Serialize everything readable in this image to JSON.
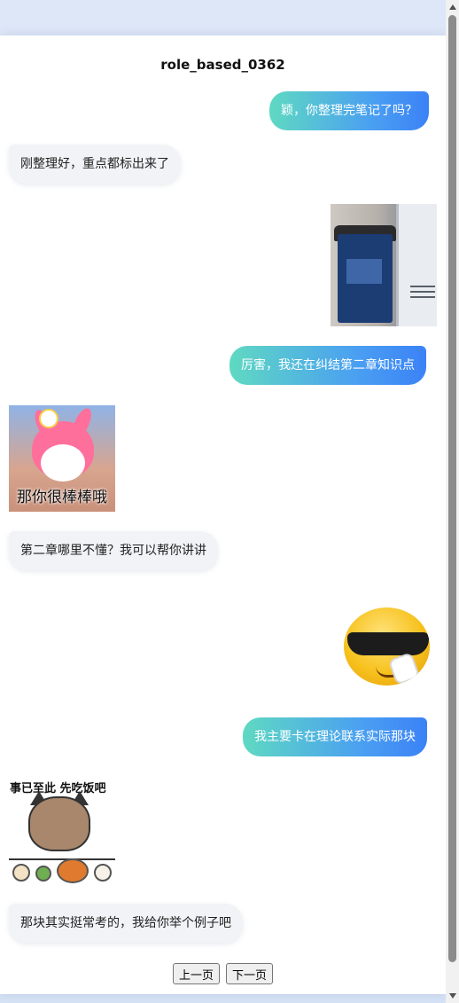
{
  "page": {
    "title": "role_based_0362"
  },
  "messages": [
    {
      "from": "me",
      "type": "text",
      "text": "颖，你整理完笔记了吗？"
    },
    {
      "from": "them",
      "type": "text",
      "text": "刚整理好，重点都标出来了"
    },
    {
      "from": "me",
      "type": "image",
      "icon": "trash-bin-photo"
    },
    {
      "from": "me",
      "type": "text",
      "text": "厉害，我还在纠结第二章知识点"
    },
    {
      "from": "them",
      "type": "sticker",
      "icon": "pink-rabbit-sticker",
      "caption": "那你很棒棒哦"
    },
    {
      "from": "them",
      "type": "text",
      "text": "第二章哪里不懂？我可以帮你讲讲"
    },
    {
      "from": "me",
      "type": "sticker",
      "icon": "sunglasses-emoji"
    },
    {
      "from": "me",
      "type": "text",
      "text": "我主要卡在理论联系实际那块"
    },
    {
      "from": "them",
      "type": "sticker",
      "icon": "cat-eating-sticker",
      "caption": "事已至此 先吃饭吧"
    },
    {
      "from": "them",
      "type": "text",
      "text": "那块其实挺常考的，我给你举个例子吧"
    }
  ],
  "pager": {
    "prev_label": "上一页",
    "next_label": "下一页"
  },
  "colors": {
    "me_bubble_start": "#5fd9c2",
    "me_bubble_end": "#3b82f6",
    "them_bubble": "#f1f3f6"
  }
}
